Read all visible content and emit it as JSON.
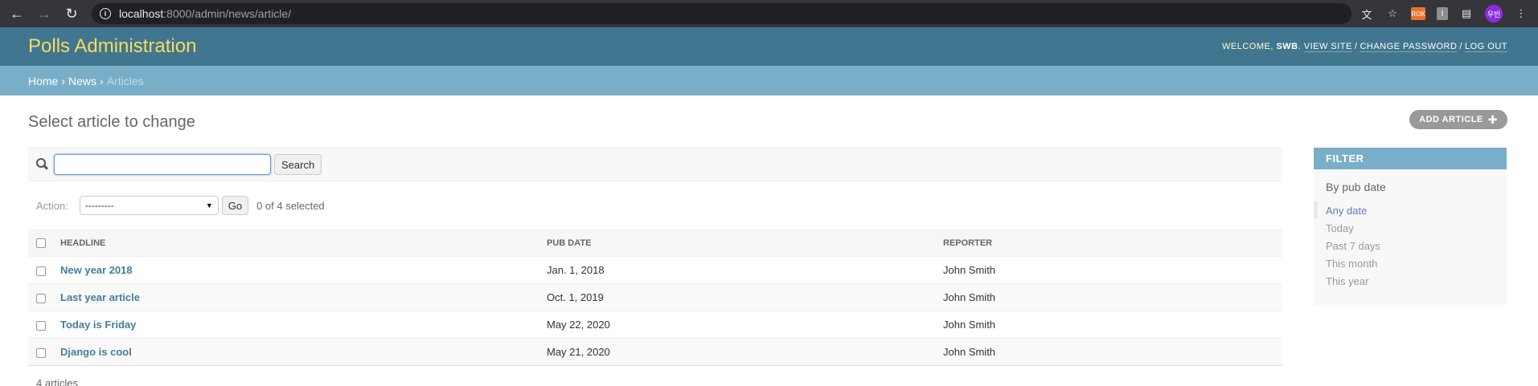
{
  "browser": {
    "url_host": "localhost",
    "url_rest": ":8000/admin/news/article/",
    "profile_initials": "우빈",
    "ext_orange": "ROK",
    "ext_gray": "I"
  },
  "header": {
    "site_name": "Polls Administration",
    "welcome": "Welcome,",
    "username": "SWB",
    "view_site": "View site",
    "change_password": "Change password",
    "log_out": "Log out"
  },
  "breadcrumbs": {
    "home": "Home",
    "app": "News",
    "current": "Articles"
  },
  "page": {
    "title": "Select article to change",
    "add_button": "Add article"
  },
  "search": {
    "value": "",
    "button": "Search"
  },
  "actions": {
    "label": "Action:",
    "selected_option": "---------",
    "go": "Go",
    "counter": "0 of 4 selected"
  },
  "table": {
    "columns": [
      "Headline",
      "Pub date",
      "Reporter"
    ],
    "rows": [
      {
        "headline": "New year 2018",
        "pub_date": "Jan. 1, 2018",
        "reporter": "John Smith"
      },
      {
        "headline": "Last year article",
        "pub_date": "Oct. 1, 2019",
        "reporter": "John Smith"
      },
      {
        "headline": "Today is Friday",
        "pub_date": "May 22, 2020",
        "reporter": "John Smith"
      },
      {
        "headline": "Django is cool",
        "pub_date": "May 21, 2020",
        "reporter": "John Smith"
      }
    ],
    "paginator": "4 articles"
  },
  "filter": {
    "title": "Filter",
    "by": "By pub date",
    "options": [
      "Any date",
      "Today",
      "Past 7 days",
      "This month",
      "This year"
    ],
    "selected": "Any date"
  }
}
